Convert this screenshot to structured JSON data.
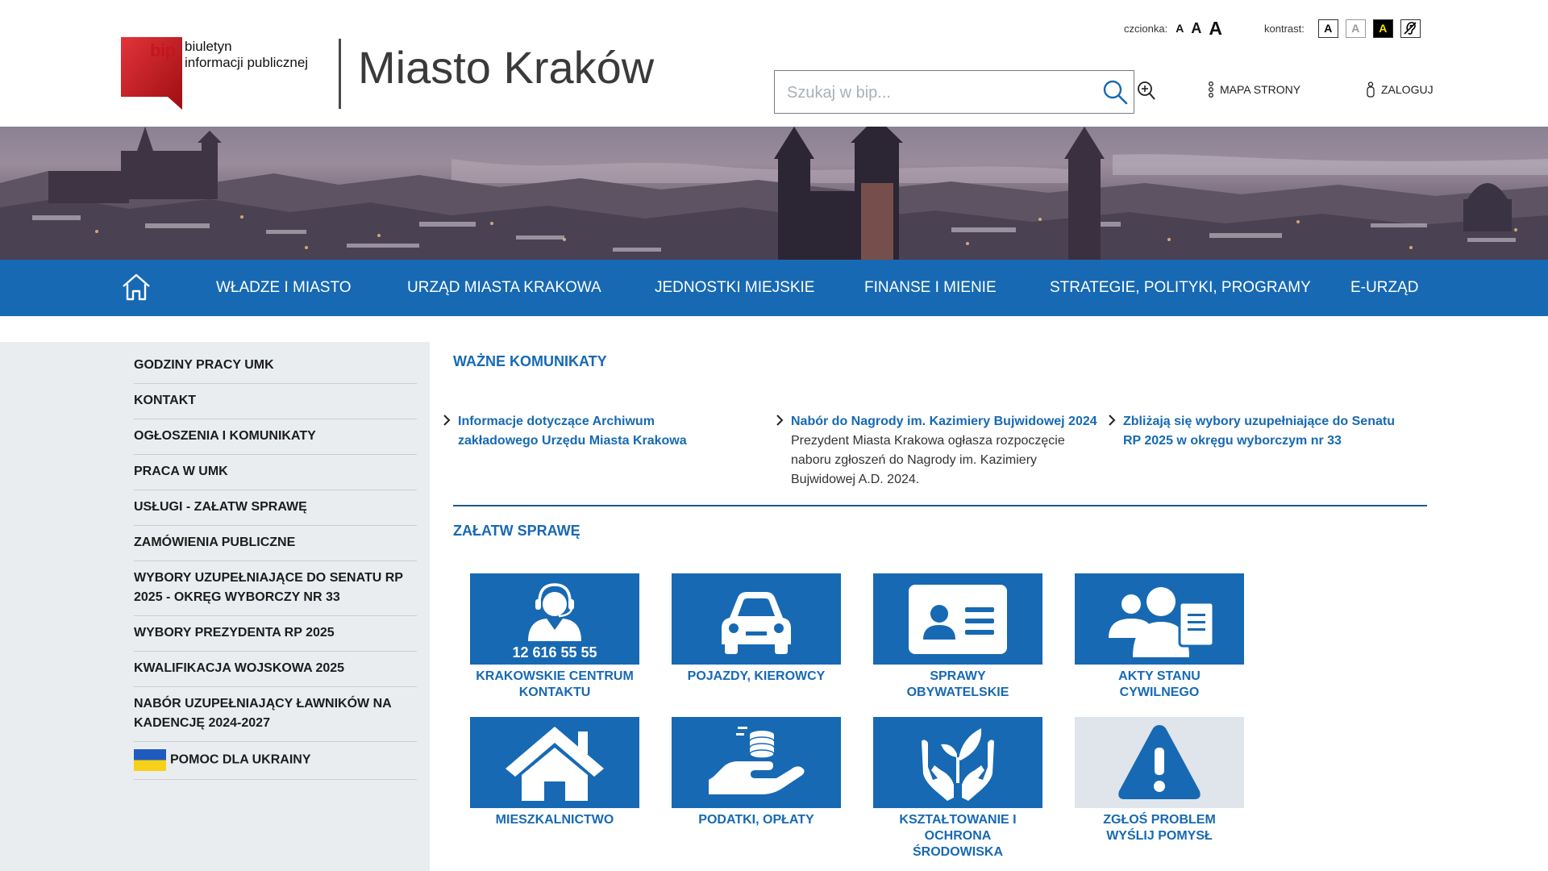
{
  "header": {
    "logo": {
      "bip_word": "bip",
      "line1": "biuletyn",
      "line2": "informacji publicznej"
    },
    "site_title": "Miasto Kraków",
    "font_size": {
      "label": "czcionka:",
      "small": "A",
      "medium": "A",
      "large": "A"
    },
    "contrast": {
      "label": "kontrast:",
      "normal": "A",
      "grey": "A",
      "yellow_black": "A"
    },
    "search": {
      "placeholder": "Szukaj w bip...",
      "value": ""
    },
    "sitemap_label": "MAPA STRONY",
    "login_label": "ZALOGUJ"
  },
  "nav": {
    "items": [
      "WŁADZE I MIASTO",
      "URZĄD MIASTA KRAKOWA",
      "JEDNOSTKI MIEJSKIE",
      "FINANSE I MIENIE",
      "STRATEGIE, POLITYKI, PROGRAMY",
      "E-URZĄD"
    ]
  },
  "sidebar": {
    "items": [
      "GODZINY PRACY UMK",
      "KONTAKT",
      "OGŁOSZENIA I KOMUNIKATY",
      "PRACA W UMK",
      "USŁUGI - ZAŁATW SPRAWĘ",
      "ZAMÓWIENIA PUBLICZNE",
      "WYBORY UZUPEŁNIAJĄCE DO SENATU RP 2025 - OKRĘG WYBORCZY NR 33",
      "WYBORY PREZYDENTA RP 2025",
      "KWALIFIKACJA WOJSKOWA 2025",
      "NABÓR UZUPEŁNIAJĄCY ŁAWNIKÓW NA KADENCJĘ 2024-2027",
      "POMOC DLA UKRAINY"
    ]
  },
  "notices": {
    "title": "WAŻNE KOMUNIKATY",
    "items": [
      {
        "title": "Informacje dotyczące Archiwum zakładowego Urzędu Miasta Krakowa",
        "desc": ""
      },
      {
        "title": "Nabór do Nagrody im. Kazimiery Bujwidowej 2024",
        "desc": "Prezydent Miasta Krakowa ogłasza rozpoczęcie naboru zgłoszeń do Nagrody im. Kazimiery Bujwidowej A.D. 2024."
      },
      {
        "title": "Zbliżają się wybory uzupełniające do Senatu RP 2025 w okręgu wyborczym nr 33",
        "desc": ""
      }
    ]
  },
  "tasks": {
    "title": "ZAŁATW SPRAWĘ",
    "tiles": [
      {
        "label": "KRAKOWSKIE CENTRUM KONTAKTU",
        "phone": "12 616 55 55",
        "icon": "headset-agent-icon"
      },
      {
        "label": "POJAZDY, KIEROWCY",
        "icon": "car-icon"
      },
      {
        "label": "SPRAWY OBYWATELSKIE",
        "icon": "id-card-icon"
      },
      {
        "label": "AKTY STANU CYWILNEGO",
        "icon": "people-document-icon"
      },
      {
        "label": "MIESZKALNICTWO",
        "icon": "house-icon"
      },
      {
        "label": "PODATKI, OPŁATY",
        "icon": "hand-coins-icon"
      },
      {
        "label": "KSZTAŁTOWANIE I OCHRONA ŚRODOWISKA",
        "icon": "hands-plant-icon"
      },
      {
        "label": "ZGŁOŚ PROBLEM WYŚLIJ POMYSŁ",
        "icon": "warning-icon"
      }
    ]
  },
  "colors": {
    "brand_blue": "#1769b3",
    "bip_red": "#c4161c",
    "sidebar_bg": "#eaedf0",
    "alert_tile_bg": "#dfe5ea"
  }
}
